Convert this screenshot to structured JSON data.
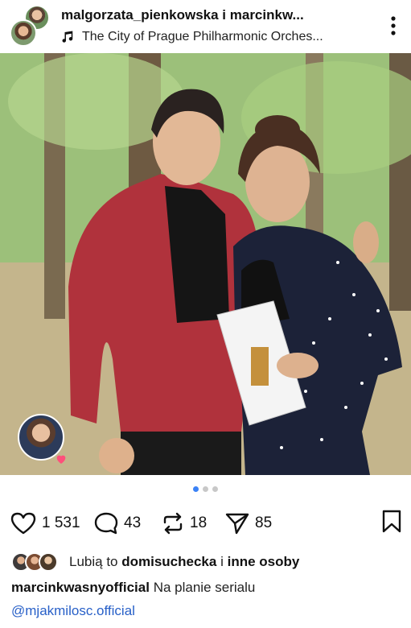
{
  "header": {
    "users": "malgorzata_pienkowska i marcinkw...",
    "music": "The City of Prague Philharmonic Orches..."
  },
  "carousel": {
    "count": 3,
    "active_index": 0
  },
  "actions": {
    "likes": "1 531",
    "comments": "43",
    "reposts": "18",
    "shares": "85"
  },
  "likes_line": {
    "prefix": "Lubią to",
    "user": "domisuchecka",
    "connector": "i",
    "others": "inne osoby"
  },
  "caption": {
    "author": "marcinkwasnyofficial",
    "text": "Na planie serialu",
    "mention": "@mjakmilosc.official"
  },
  "icons": [
    "more-icon",
    "music-note-icon",
    "heart-icon",
    "comment-icon",
    "repost-icon",
    "share-icon",
    "bookmark-icon",
    "person-tag-icon",
    "mute-icon"
  ],
  "colors": {
    "accent": "#3b82f6",
    "mention": "#2860c8",
    "heart_badge": "#ff4f7b"
  }
}
